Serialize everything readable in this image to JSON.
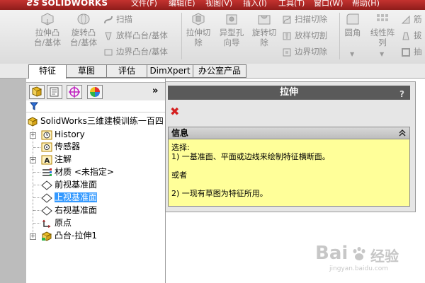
{
  "app": {
    "logo": "SOLIDWORKS",
    "menus": [
      "文件(F)",
      "编辑(E)",
      "视图(V)",
      "插入(I)",
      "工具(T)",
      "窗口(W)",
      "帮助(H)"
    ]
  },
  "ribbon": {
    "buttons": [
      {
        "line1": "拉伸凸",
        "line2": "台/基体",
        "icon": "extrude-boss-icon"
      },
      {
        "line1": "旋转凸",
        "line2": "台/基体",
        "icon": "revolve-boss-icon"
      },
      {
        "line1": "拉伸切",
        "line2": "除",
        "icon": "extrude-cut-icon"
      },
      {
        "line1": "异型孔",
        "line2": "向导",
        "icon": "hole-wizard-icon"
      },
      {
        "line1": "旋转切",
        "line2": "除",
        "icon": "revolve-cut-icon"
      },
      {
        "line1": "圆角",
        "line2": "",
        "icon": "fillet-icon"
      },
      {
        "line1": "线性阵",
        "line2": "列",
        "icon": "linear-pattern-icon"
      }
    ],
    "small_items": [
      {
        "label": "扫描",
        "icon": "sweep-icon"
      },
      {
        "label": "放样凸台/基体",
        "icon": "loft-icon"
      },
      {
        "label": "边界凸台/基体",
        "icon": "boundary-boss-icon"
      },
      {
        "label": "扫描切除",
        "icon": "sweep-cut-icon"
      },
      {
        "label": "放样切割",
        "icon": "loft-cut-icon"
      },
      {
        "label": "边界切除",
        "icon": "boundary-cut-icon"
      },
      {
        "label": "筋",
        "icon": "rib-icon"
      },
      {
        "label": "拔",
        "icon": "draft-icon"
      },
      {
        "label": "抽",
        "icon": "shell-icon"
      }
    ]
  },
  "tabs": [
    "特征",
    "草图",
    "评估",
    "DimXpert",
    "办公室产品"
  ],
  "tree": {
    "collapse_glyph": "»",
    "root": "SolidWorks三维建模训练一百四",
    "items": [
      {
        "label": "History",
        "icon": "history-icon",
        "expandable": true
      },
      {
        "label": "传感器",
        "icon": "sensors-icon",
        "expandable": false
      },
      {
        "label": "注解",
        "icon": "annotations-icon",
        "expandable": true
      },
      {
        "label": "材质 <未指定>",
        "icon": "material-icon",
        "expandable": false
      },
      {
        "label": "前视基准面",
        "icon": "plane-icon",
        "expandable": false
      },
      {
        "label": "上视基准面",
        "icon": "plane-icon",
        "expandable": false,
        "selected": true
      },
      {
        "label": "右视基准面",
        "icon": "plane-icon",
        "expandable": false
      },
      {
        "label": "原点",
        "icon": "origin-icon",
        "expandable": false
      },
      {
        "label": "凸台-拉伸1",
        "icon": "boss-extrude-icon",
        "expandable": true
      }
    ]
  },
  "property_manager": {
    "title": "拉伸",
    "help_glyph": "?",
    "cancel_glyph": "✖",
    "info": {
      "header": "信息",
      "collapse_glyph": "≈",
      "lines": [
        "选择:",
        "1) 一基准面、平面或边线来绘制特征横断面。",
        "或者",
        "2) 一现有草图为特征所用。"
      ]
    }
  },
  "watermark": {
    "text": "Bai",
    "text2": "经验",
    "sub": "jingyan.baidu.com"
  },
  "colors": {
    "title_bar": "#b02a27",
    "info_bg": "#ffff99",
    "selection": "#3399ff",
    "pm_header": "#5a5a5a",
    "cancel": "#d42020"
  }
}
